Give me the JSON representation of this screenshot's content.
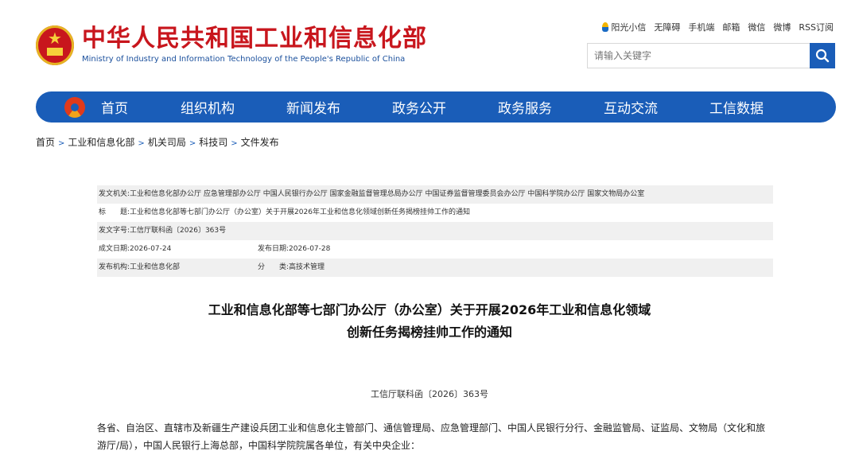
{
  "site": {
    "name_cn": "中华人民共和国工业和信息化部",
    "name_en": "Ministry of Industry and Information Technology of the People's Republic of China"
  },
  "toplinks": [
    "阳光小信",
    "无障碍",
    "手机端",
    "邮箱",
    "微信",
    "微博",
    "RSS订阅"
  ],
  "search": {
    "placeholder": "请输入关键字"
  },
  "nav": [
    "首页",
    "组织机构",
    "新闻发布",
    "政务公开",
    "政务服务",
    "互动交流",
    "工信数据"
  ],
  "breadcrumb": [
    "首页",
    "工业和信息化部",
    "机关司局",
    "科技司",
    "文件发布"
  ],
  "meta": {
    "issuer_label": "发文机关:",
    "issuer": "工业和信息化部办公厅 应急管理部办公厅 中国人民银行办公厅 国家金融监督管理总局办公厅 中国证券监督管理委员会办公厅 中国科学院办公厅 国家文物局办公室",
    "title_label": "标　　题:",
    "title": "工业和信息化部等七部门办公厅（办公室）关于开展2026年工业和信息化领域创新任务揭榜挂帅工作的通知",
    "docno_label": "发文字号:",
    "docno": "工信厅联科函〔2026〕363号",
    "written_label": "成文日期:",
    "written": "2026-07-24",
    "published_label": "发布日期:",
    "published": "2026-07-28",
    "org_label": "发布机构:",
    "org": "工业和信息化部",
    "category_label": "分　　类:",
    "category": "高技术管理"
  },
  "article": {
    "title_line1": "工业和信息化部等七部门办公厅（办公室）关于开展2026年工业和信息化领域",
    "title_line2": "创新任务揭榜挂帅工作的通知",
    "docno": "工信厅联科函〔2026〕363号",
    "body": "各省、自治区、直辖市及新疆生产建设兵团工业和信息化主管部门、通信管理局、应急管理部门、中国人民银行分行、金融监管局、证监局、文物局（文化和旅游厅/局），中国人民银行上海总部，中国科学院院属各单位，有关中央企业："
  }
}
